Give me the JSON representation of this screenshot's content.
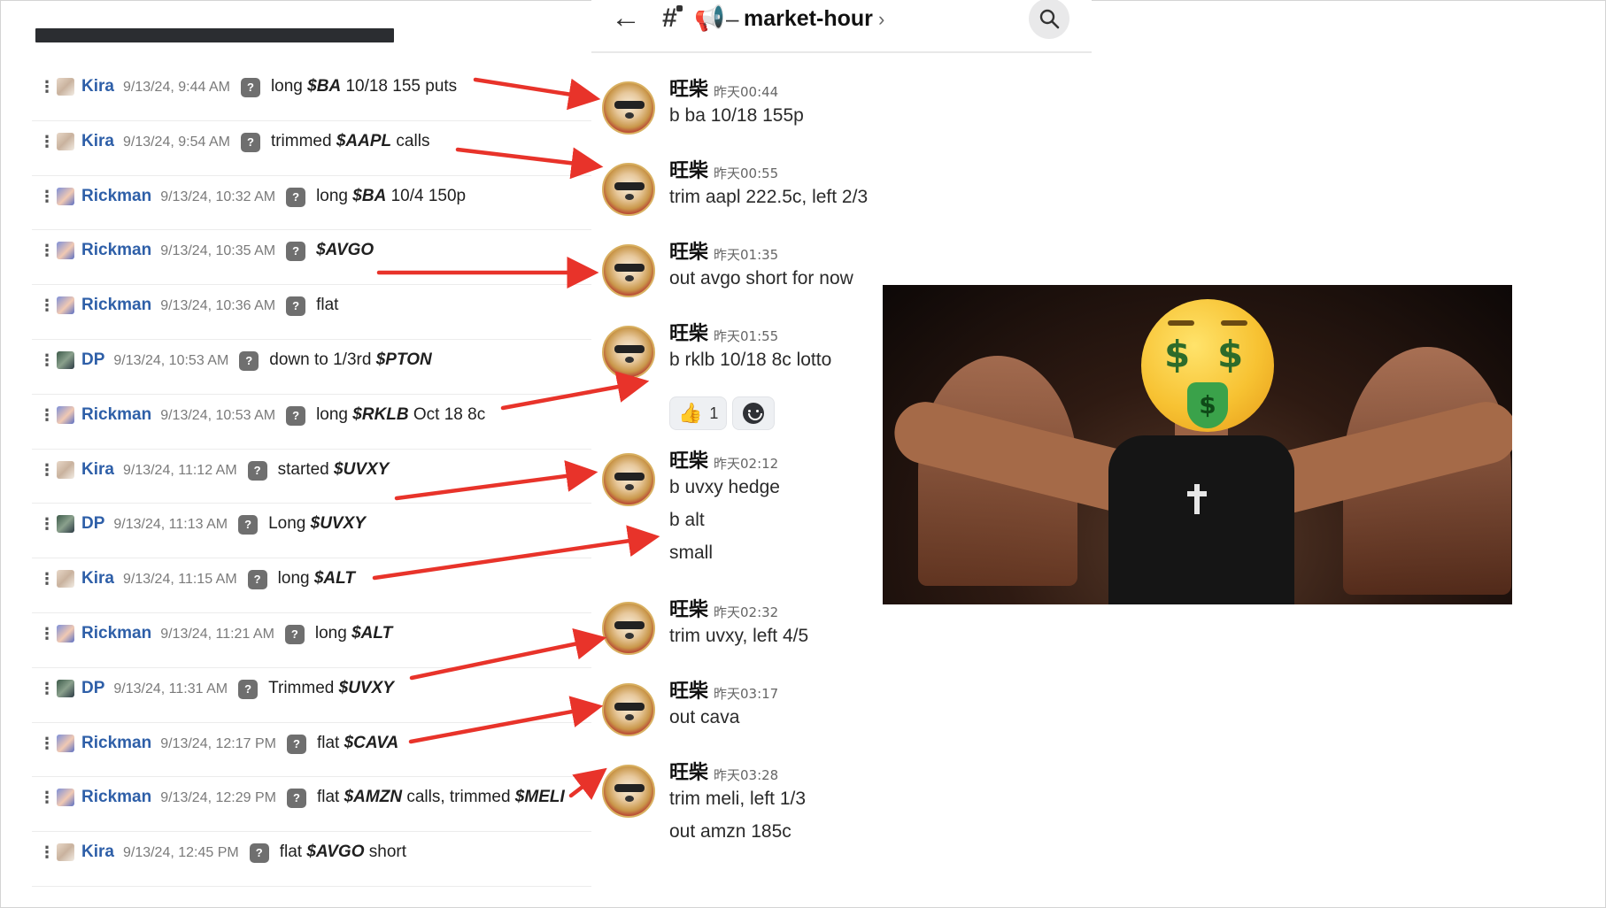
{
  "channel": {
    "title": "market-hour",
    "dash": "–",
    "chevron": "›",
    "back_icon": "arrow-left-icon",
    "hash_icon": "locked-hash-channel-icon",
    "megaphone_icon": "megaphone-icon",
    "search_icon": "search-icon"
  },
  "log": [
    {
      "author": "Kira",
      "avatar": "kira",
      "time": "9/13/24, 9:44 AM",
      "parts": [
        [
          "t",
          "long "
        ],
        [
          "b",
          "$BA"
        ],
        [
          "t",
          " 10/18 155 puts"
        ]
      ]
    },
    {
      "author": "Kira",
      "avatar": "kira",
      "time": "9/13/24, 9:54 AM",
      "parts": [
        [
          "t",
          "trimmed "
        ],
        [
          "b",
          "$AAPL"
        ],
        [
          "t",
          " calls"
        ]
      ]
    },
    {
      "author": "Rickman",
      "avatar": "rickman",
      "time": "9/13/24, 10:32 AM",
      "parts": [
        [
          "t",
          "long "
        ],
        [
          "b",
          "$BA"
        ],
        [
          "t",
          " 10/4 150p"
        ]
      ]
    },
    {
      "author": "Rickman",
      "avatar": "rickman",
      "time": "9/13/24, 10:35 AM",
      "parts": [
        [
          "b",
          "$AVGO"
        ]
      ]
    },
    {
      "author": "Rickman",
      "avatar": "rickman",
      "time": "9/13/24, 10:36 AM",
      "parts": [
        [
          "t",
          "flat"
        ]
      ]
    },
    {
      "author": "DP",
      "avatar": "dp",
      "time": "9/13/24, 10:53 AM",
      "parts": [
        [
          "t",
          "down to 1/3rd "
        ],
        [
          "b",
          "$PTON"
        ]
      ]
    },
    {
      "author": "Rickman",
      "avatar": "rickman",
      "time": "9/13/24, 10:53 AM",
      "parts": [
        [
          "t",
          "long "
        ],
        [
          "b",
          "$RKLB"
        ],
        [
          "t",
          " Oct 18 8c"
        ]
      ]
    },
    {
      "author": "Kira",
      "avatar": "kira",
      "time": "9/13/24, 11:12 AM",
      "parts": [
        [
          "t",
          "started "
        ],
        [
          "b",
          "$UVXY"
        ]
      ]
    },
    {
      "author": "DP",
      "avatar": "dp",
      "time": "9/13/24, 11:13 AM",
      "parts": [
        [
          "t",
          "Long "
        ],
        [
          "b",
          "$UVXY"
        ]
      ]
    },
    {
      "author": "Kira",
      "avatar": "kira",
      "time": "9/13/24, 11:15 AM",
      "parts": [
        [
          "t",
          "long "
        ],
        [
          "b",
          "$ALT"
        ]
      ]
    },
    {
      "author": "Rickman",
      "avatar": "rickman",
      "time": "9/13/24, 11:21 AM",
      "parts": [
        [
          "t",
          "long "
        ],
        [
          "b",
          "$ALT"
        ]
      ]
    },
    {
      "author": "DP",
      "avatar": "dp",
      "time": "9/13/24, 11:31 AM",
      "parts": [
        [
          "t",
          "Trimmed "
        ],
        [
          "b",
          "$UVXY"
        ]
      ]
    },
    {
      "author": "Rickman",
      "avatar": "rickman",
      "time": "9/13/24, 12:17 PM",
      "parts": [
        [
          "t",
          "flat "
        ],
        [
          "b",
          "$CAVA"
        ]
      ]
    },
    {
      "author": "Rickman",
      "avatar": "rickman",
      "time": "9/13/24, 12:29 PM",
      "parts": [
        [
          "t",
          "flat "
        ],
        [
          "b",
          "$AMZN"
        ],
        [
          "t",
          " calls, trimmed "
        ],
        [
          "b",
          "$MELI"
        ]
      ]
    },
    {
      "author": "Kira",
      "avatar": "kira",
      "time": "9/13/24, 12:45 PM",
      "parts": [
        [
          "t",
          "flat "
        ],
        [
          "b",
          "$AVGO"
        ],
        [
          "t",
          " short"
        ]
      ]
    }
  ],
  "chat": [
    {
      "name": "旺柴",
      "time": "昨天00:44",
      "lines": [
        "b ba 10/18 155p"
      ]
    },
    {
      "name": "旺柴",
      "time": "昨天00:55",
      "lines": [
        "trim aapl 222.5c, left 2/3"
      ]
    },
    {
      "name": "旺柴",
      "time": "昨天01:35",
      "lines": [
        "out avgo short for now"
      ]
    },
    {
      "name": "旺柴",
      "time": "昨天01:55",
      "lines": [
        "b rklb 10/18 8c lotto"
      ],
      "reaction": {
        "emoji": "👍",
        "count": "1"
      }
    },
    {
      "name": "旺柴",
      "time": "昨天02:12",
      "lines": [
        "b uvxy hedge",
        "b alt",
        "small"
      ]
    },
    {
      "name": "旺柴",
      "time": "昨天02:32",
      "lines": [
        "trim uvxy, left 4/5"
      ]
    },
    {
      "name": "旺柴",
      "time": "昨天03:17",
      "lines": [
        "out cava"
      ]
    },
    {
      "name": "旺柴",
      "time": "昨天03:28",
      "lines": [
        "trim meli, left 1/3",
        "out amzn 185c"
      ]
    }
  ],
  "meme": {
    "dollar": "$",
    "tongue": "$"
  },
  "colors": {
    "author": "#2e5fa8",
    "arrow": "#e8332a"
  }
}
